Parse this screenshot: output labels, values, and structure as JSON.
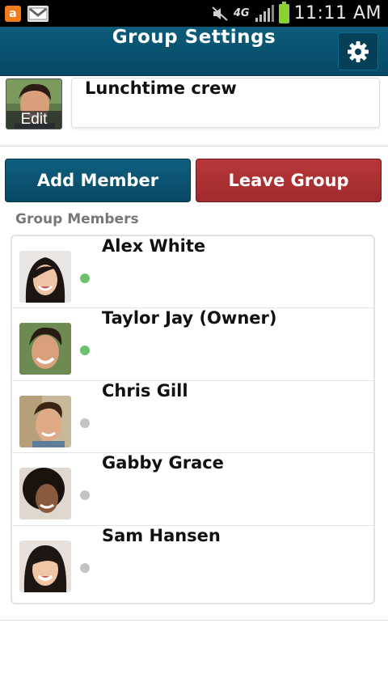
{
  "status_bar": {
    "app_icon_letter": "a",
    "network": "4G",
    "time": "11:11 AM"
  },
  "header": {
    "title": "Group Settings",
    "settings_icon": "gear-icon"
  },
  "group": {
    "edit_label": "Edit",
    "name": "Lunchtime crew"
  },
  "actions": {
    "add_member": "Add Member",
    "leave_group": "Leave Group"
  },
  "members_section": {
    "label": "Group Members",
    "members": [
      {
        "name": "Alex White",
        "online": true
      },
      {
        "name": "Taylor Jay (Owner)",
        "online": true
      },
      {
        "name": "Chris Gill",
        "online": false
      },
      {
        "name": "Gabby Grace",
        "online": false
      },
      {
        "name": "Sam Hansen",
        "online": false
      }
    ]
  },
  "colors": {
    "header": "#0b5b7a",
    "add_button": "#0f5f80",
    "leave_button": "#b7383a",
    "online": "#6cc16e",
    "offline": "#c4c4c4"
  }
}
